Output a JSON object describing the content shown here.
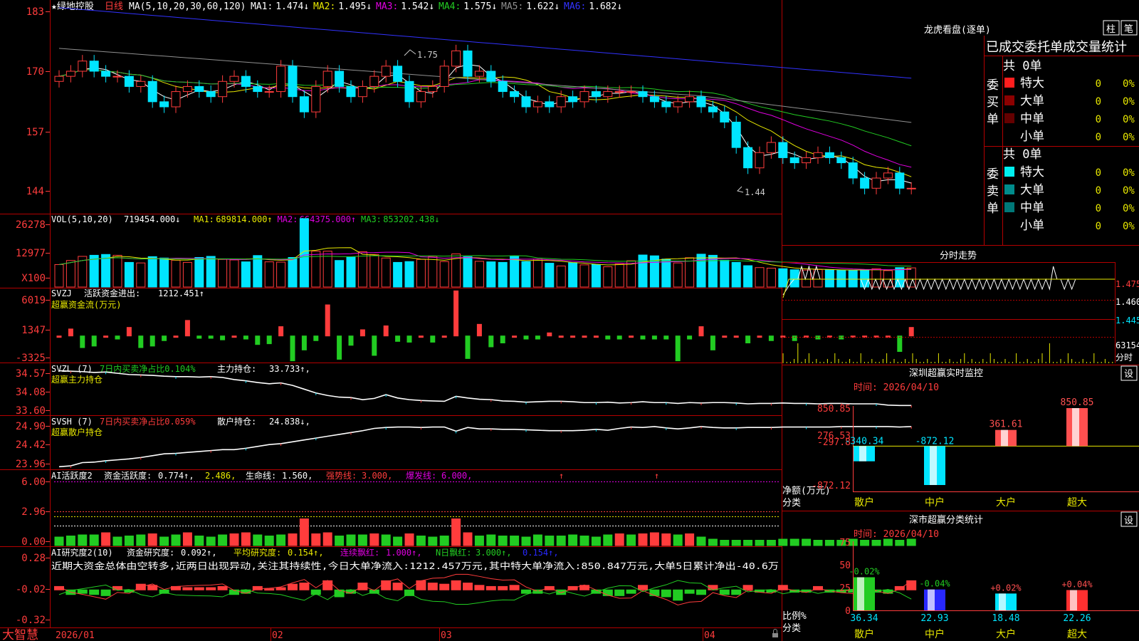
{
  "colors": {
    "up": "#ff3c3c",
    "down": "#00e5ff",
    "frame": "#b40000",
    "green": "#22cc22",
    "ma1": "#ffffff",
    "ma2": "#e8e800",
    "ma3": "#e000e0",
    "ma4": "#22cc22",
    "ma5": "#909090",
    "ma6": "#3232ff"
  },
  "title": {
    "stock": "★绿地控股",
    "period": "日线",
    "ma_group": "MA(5,10,20,30,60,120)",
    "ma": [
      {
        "label": "MA1:",
        "value": "1.474↓",
        "color": "#ffffff"
      },
      {
        "label": "MA2:",
        "value": "1.495↓",
        "color": "#e8e800"
      },
      {
        "label": "MA3:",
        "value": "1.542↓",
        "color": "#e000e0"
      },
      {
        "label": "MA4:",
        "value": "1.575↓",
        "color": "#22cc22"
      },
      {
        "label": "MA5:",
        "value": "1.622↓",
        "color": "#909090"
      },
      {
        "label": "MA6:",
        "value": "1.682↓",
        "color": "#3232ff"
      }
    ]
  },
  "price_axis": [
    "183",
    "170",
    "157",
    "144"
  ],
  "price_marks": {
    "high": "1.75",
    "low": "1.44"
  },
  "chart_data": [
    {
      "type": "candlestick",
      "name": "price",
      "ylim": [
        1.42,
        1.84
      ],
      "values": [
        1.69,
        1.7,
        1.72,
        1.7,
        1.69,
        1.69,
        1.67,
        1.68,
        1.64,
        1.63,
        1.66,
        1.67,
        1.66,
        1.65,
        1.68,
        1.69,
        1.67,
        1.66,
        1.66,
        1.71,
        1.65,
        1.62,
        1.67,
        1.7,
        1.67,
        1.65,
        1.67,
        1.69,
        1.71,
        1.68,
        1.64,
        1.66,
        1.67,
        1.71,
        1.74,
        1.69,
        1.7,
        1.68,
        1.66,
        1.65,
        1.63,
        1.64,
        1.63,
        1.65,
        1.64,
        1.66,
        1.65,
        1.66,
        1.66,
        1.66,
        1.65,
        1.64,
        1.63,
        1.64,
        1.65,
        1.63,
        1.62,
        1.6,
        1.55,
        1.51,
        1.54,
        1.56,
        1.53,
        1.52,
        1.53,
        1.54,
        1.53,
        1.52,
        1.49,
        1.47,
        1.49,
        1.5,
        1.47,
        1.47
      ]
    },
    {
      "type": "bar",
      "name": "VOL",
      "ylim": [
        0,
        26278
      ],
      "axis": [
        "26278",
        "12977",
        "X100"
      ],
      "values": [
        8200,
        9700,
        11200,
        11600,
        11900,
        11600,
        9000,
        8800,
        11100,
        10600,
        9800,
        9000,
        10800,
        11200,
        10100,
        9900,
        9200,
        11500,
        9200,
        9100,
        10800,
        25000,
        13100,
        13100,
        9700,
        10900,
        12900,
        11900,
        10600,
        9000,
        9300,
        10100,
        11200,
        9300,
        12100,
        11100,
        9400,
        9200,
        9000,
        11200,
        9300,
        10200,
        8700,
        7700,
        8900,
        8100,
        8200,
        7400,
        8400,
        9600,
        11700,
        11400,
        10200,
        8800,
        10700,
        12000,
        11600,
        9800,
        9000,
        7800,
        7100,
        6900,
        6700,
        6300,
        6200,
        6400,
        6400,
        6100,
        6000,
        6300,
        6700,
        6000,
        7100,
        7000
      ]
    },
    {
      "type": "bar",
      "name": "SVZJ",
      "ylim": [
        -3325,
        6019
      ],
      "axis": [
        "6019",
        "1347",
        "-3325"
      ],
      "values": [
        0,
        900,
        -1500,
        -1300,
        0,
        -400,
        1100,
        -1500,
        -1300,
        -600,
        0,
        2000,
        -300,
        -300,
        -500,
        0,
        -400,
        -1100,
        -1000,
        1200,
        -3200,
        -1800,
        -600,
        4000,
        -3000,
        -1200,
        800,
        -2500,
        1300,
        -700,
        -800,
        0,
        -800,
        0,
        5800,
        -2900,
        1500,
        -1400,
        -900,
        0,
        -400,
        -400,
        400,
        0,
        0,
        0,
        0,
        -400,
        -400,
        0,
        -400,
        -400,
        -400,
        -3200,
        -400,
        1200,
        -1800,
        0,
        0,
        -900,
        0,
        -600,
        0,
        -600,
        0,
        -400,
        0,
        -400,
        0,
        0,
        0,
        0,
        -2000,
        1100
      ]
    },
    {
      "type": "line",
      "name": "SVZL",
      "ylim": [
        33.6,
        34.57
      ],
      "axis": [
        "34.57",
        "34.08",
        "33.60"
      ],
      "values": [
        34.56,
        34.55,
        34.54,
        34.52,
        34.53,
        34.5,
        34.47,
        34.46,
        34.45,
        34.43,
        34.42,
        34.42,
        34.41,
        34.42,
        34.4,
        34.35,
        34.32,
        34.28,
        34.25,
        34.27,
        34.21,
        34.12,
        34.03,
        33.97,
        33.93,
        33.92,
        33.87,
        33.9,
        33.99,
        33.91,
        33.87,
        33.85,
        33.84,
        33.83,
        33.95,
        33.91,
        33.88,
        33.87,
        33.84,
        33.83,
        33.81,
        33.82,
        33.83,
        33.83,
        33.82,
        33.8,
        33.8,
        33.81,
        33.79,
        33.8,
        33.82,
        33.8,
        33.8,
        33.78,
        33.8,
        33.79,
        33.8,
        33.8,
        33.79,
        33.77,
        33.78,
        33.78,
        33.79,
        33.78,
        33.78,
        33.77,
        33.78,
        33.78,
        33.77,
        33.77,
        33.77,
        33.74,
        33.73,
        33.73
      ]
    },
    {
      "type": "line",
      "name": "SVSH",
      "ylim": [
        23.96,
        24.9
      ],
      "axis": [
        "24.90",
        "24.42",
        "23.96"
      ],
      "values": [
        23.97,
        23.99,
        24.06,
        24.07,
        24.1,
        24.12,
        24.14,
        24.17,
        24.21,
        24.25,
        24.26,
        24.28,
        24.3,
        24.32,
        24.34,
        24.34,
        24.37,
        24.41,
        24.45,
        24.47,
        24.51,
        24.55,
        24.59,
        24.63,
        24.67,
        24.71,
        24.75,
        24.8,
        24.82,
        24.83,
        24.83,
        24.82,
        24.83,
        24.83,
        24.74,
        24.82,
        24.79,
        24.79,
        24.78,
        24.78,
        24.77,
        24.76,
        24.75,
        24.75,
        24.75,
        24.76,
        24.78,
        24.76,
        24.8,
        24.83,
        24.82,
        24.84,
        24.81,
        24.79,
        24.81,
        24.84,
        24.82,
        24.81,
        24.81,
        24.82,
        24.82,
        24.82,
        24.83,
        24.83,
        24.83,
        24.83,
        24.83,
        24.84,
        24.84,
        24.84,
        24.84,
        24.84,
        24.83,
        24.84
      ]
    },
    {
      "type": "bar",
      "name": "AI活跃度2",
      "ylim": [
        0,
        6
      ],
      "axis": [
        "6.00",
        "2.96",
        "0.00"
      ],
      "values": [
        0.8,
        0.9,
        1.0,
        1.0,
        1.2,
        0.8,
        0.9,
        1.0,
        1.1,
        0.8,
        1.0,
        1.2,
        0.9,
        0.8,
        1.0,
        1.1,
        1.2,
        1.0,
        0.9,
        1.0,
        1.1,
        2.5,
        1.1,
        1.2,
        0.9,
        1.0,
        1.0,
        1.1,
        1.0,
        0.8,
        1.1,
        0.9,
        0.8,
        0.9,
        2.5,
        1.2,
        0.9,
        1.0,
        0.9,
        0.9,
        0.8,
        1.0,
        0.9,
        0.9,
        1.0,
        0.9,
        0.8,
        1.0,
        1.1,
        1.0,
        1.1,
        1.2,
        1.1,
        1.0,
        1.1,
        0.8,
        0.6,
        0.5,
        0.5,
        0.5,
        0.5,
        0.5,
        0.6,
        0.6,
        0.6,
        0.5,
        0.5,
        0.5,
        0.6,
        0.5,
        0.5,
        0.6,
        0.5,
        0.6
      ]
    },
    {
      "type": "bar",
      "name": "AI研究度2",
      "ylim": [
        -0.32,
        0.28
      ],
      "axis": [
        "0.28",
        "-0.02",
        "-0.32"
      ],
      "values": [
        0.03,
        -0.04,
        -0.03,
        -0.04,
        -0.05,
        0.03,
        -0.02,
        0.05,
        0.04,
        -0.03,
        0.03,
        0.02,
        0.02,
        0.02,
        0.03,
        -0.04,
        -0.03,
        0.03,
        0.01,
        0.02,
        0.05,
        0.06,
        -0.04,
        0.08,
        -0.06,
        -0.03,
        0.06,
        -0.03,
        0.08,
        0.06,
        -0.05,
        0.08,
        0.06,
        0.05,
        0.08,
        0.06,
        0.04,
        0.03,
        0.03,
        0.04,
        -0.03,
        -0.03,
        0.03,
        -0.04,
        0.03,
        0.04,
        -0.03,
        -0.05,
        -0.05,
        -0.03,
        0.04,
        -0.05,
        -0.06,
        -0.09,
        -0.03,
        -0.04,
        0.04,
        -0.04,
        -0.04,
        0.04,
        -0.02,
        -0.02,
        0.04,
        -0.02,
        -0.02,
        0.03,
        -0.02,
        -0.02,
        -0.02,
        0.04,
        -0.02,
        -0.03,
        0.03,
        0.08
      ]
    }
  ],
  "panels": {
    "vol": {
      "name": "VOL(5,10,20)",
      "value": "719454.000↓",
      "items": [
        {
          "t": "MA1:",
          "v": "689814.000↑",
          "c": "#e8e800"
        },
        {
          "t": "MA2:",
          "v": "664375.000↑",
          "c": "#e000e0"
        },
        {
          "t": "MA3:",
          "v": "853202.438↓",
          "c": "#22cc22"
        }
      ]
    },
    "svzj": {
      "name": "SVZJ",
      "desc": "活跃资金进出:",
      "value": "1212.451↑",
      "sub": "超赢资金流(万元)"
    },
    "svzl": {
      "name": "SVZL (7)",
      "desc": "7日内买卖净占比0.104%",
      "hold": "主力持仓:",
      "value": "33.733↑,",
      "sub": "超赢主力持仓"
    },
    "svsh": {
      "name": "SVSH (7)",
      "desc": "7日内买卖净占比0.059%",
      "hold": "散户持仓:",
      "value": "24.838↓,",
      "sub": "超赢散户持仓"
    },
    "ai1": {
      "name": "AI活跃度2",
      "t1": "资金活跃度:",
      "v1": "0.774↑,",
      "v2": "2.486,",
      "t3": "生命线:",
      "v3": "1.560,",
      "t4": "强势线:",
      "v4": "3.000,",
      "t5": "爆发线:",
      "v5": "6.000,"
    },
    "ai2": {
      "name": "AI研究度2(10)",
      "t1": "资金研究度:",
      "v1": "0.092↑,",
      "t2": "平均研究度:",
      "v2": "0.154↑,",
      "t3": "连续飘红:",
      "v3": "1.000↑,",
      "t4": "N日飘红:",
      "v4": "3.000↑,",
      "v5": "0.154↑,",
      "comment": "近期大资金总体由空转多,近两日出现异动,关注其持续性,今日大单净流入:1212.457万元,其中特大单净流入:850.847万元,大单5日累计净出-40.6万"
    }
  },
  "bottom": {
    "brand": "大智慧",
    "dates": [
      "2026/01",
      "02",
      "03",
      "04"
    ]
  },
  "right": {
    "lhkp": {
      "title": "龙虎看盘(逐单)",
      "btn1": "柱",
      "btn2": "笔"
    },
    "stats": {
      "header": "已成交委托单成交量统计",
      "buy": {
        "label": "委买单",
        "total": "共 0单",
        "rows": [
          {
            "n": "特大",
            "v": "0",
            "p": "0%",
            "c": "#ff1e1e"
          },
          {
            "n": "大单",
            "v": "0",
            "p": "0%",
            "c": "#8c0000"
          },
          {
            "n": "中单",
            "v": "0",
            "p": "0%",
            "c": "#640000"
          },
          {
            "n": "小单",
            "v": "0",
            "p": "0%",
            "c": "#000000"
          }
        ]
      },
      "sell": {
        "label": "委卖单",
        "total": "共 0单",
        "rows": [
          {
            "n": "特大",
            "v": "0",
            "p": "0%",
            "c": "#00f0f0"
          },
          {
            "n": "大单",
            "v": "0",
            "p": "0%",
            "c": "#008c8c"
          },
          {
            "n": "中单",
            "v": "0",
            "p": "0%",
            "c": "#007878"
          },
          {
            "n": "小单",
            "v": "0",
            "p": "0%",
            "c": "#000000"
          }
        ]
      }
    },
    "intraday": {
      "title": "分时走势",
      "axis": [
        "1.475",
        "1.460",
        "1.445",
        "63154",
        "分时"
      ]
    },
    "sz_monitor": {
      "title": "深圳超赢实时监控",
      "btn": "设",
      "date": "时间: 2026/04/10",
      "axis": [
        "850.85",
        "276.53",
        "-297.8",
        "-872.12"
      ],
      "ylabel1": "净额(万元)",
      "ylabel2": "分类",
      "bars": [
        {
          "label": "散户",
          "value": -340.34,
          "text": "-340.34",
          "color": "#00e5ff"
        },
        {
          "label": "中户",
          "value": -872.12,
          "text": "-872.12",
          "color": "#00e5ff"
        },
        {
          "label": "大户",
          "value": 361.61,
          "text": "361.61",
          "color": "#ff5050"
        },
        {
          "label": "超大",
          "value": 850.85,
          "text": "850.85",
          "color": "#ff5050"
        }
      ]
    },
    "sz_class": {
      "title": "深市超赢分类统计",
      "btn": "设",
      "date": "时间: 2026/04/10",
      "axis": [
        "75",
        "50",
        "25",
        "0"
      ],
      "ylabel1": "比例%",
      "ylabel2": "分类",
      "bars": [
        {
          "label": "散户",
          "value": 36.34,
          "text": "36.34",
          "delta": "-0.02%",
          "color": "#22cc22",
          "dcolor": "#22cc22"
        },
        {
          "label": "中户",
          "value": 22.93,
          "text": "22.93",
          "delta": "-0.04%",
          "color": "#2828ff",
          "dcolor": "#22cc22"
        },
        {
          "label": "大户",
          "value": 18.48,
          "text": "18.48",
          "delta": "+0.02%",
          "color": "#00e5ff",
          "dcolor": "#ff5050"
        },
        {
          "label": "超大",
          "value": 22.26,
          "text": "22.26",
          "delta": "+0.04%",
          "color": "#ff3030",
          "dcolor": "#ff5050"
        }
      ]
    }
  }
}
